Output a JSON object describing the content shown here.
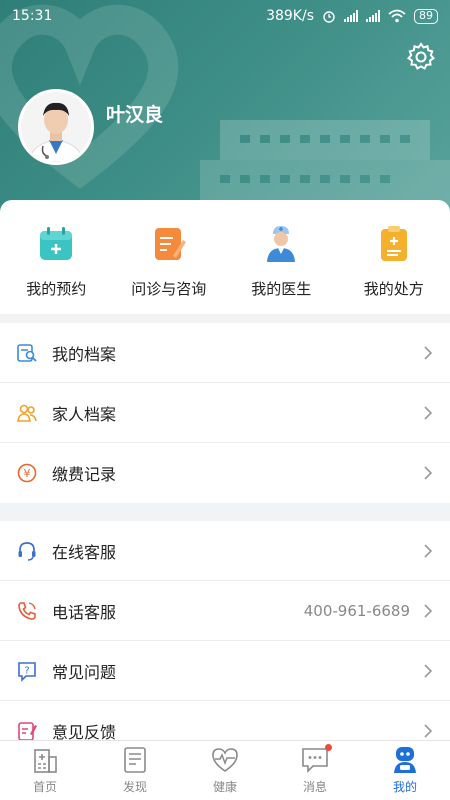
{
  "status_bar": {
    "time": "15:31",
    "network_speed": "389K/s",
    "battery": "89"
  },
  "profile": {
    "name": "叶汉良",
    "settings_icon": "gear-icon"
  },
  "quick_actions": [
    {
      "label": "我的预约",
      "icon": "calendar-icon",
      "color": "#3cc4c2"
    },
    {
      "label": "问诊与咨询",
      "icon": "consult-note-icon",
      "color": "#f58a3d"
    },
    {
      "label": "我的医生",
      "icon": "doctor-icon",
      "color": "#3c8ad8"
    },
    {
      "label": "我的处方",
      "icon": "prescription-icon",
      "color": "#f5b12e"
    }
  ],
  "records_menu": [
    {
      "label": "我的档案",
      "icon": "profile-search-icon"
    },
    {
      "label": "家人档案",
      "icon": "family-icon"
    },
    {
      "label": "缴费记录",
      "icon": "payment-icon"
    }
  ],
  "service_menu": [
    {
      "label": "在线客服",
      "icon": "headset-icon",
      "value": ""
    },
    {
      "label": "电话客服",
      "icon": "phone-icon",
      "value": "400-961-6689"
    },
    {
      "label": "常见问题",
      "icon": "faq-icon",
      "value": ""
    },
    {
      "label": "意见反馈",
      "icon": "feedback-icon",
      "value": ""
    }
  ],
  "tabs": [
    {
      "label": "首页",
      "icon": "hospital-icon"
    },
    {
      "label": "发现",
      "icon": "discover-icon"
    },
    {
      "label": "健康",
      "icon": "heart-pulse-icon"
    },
    {
      "label": "消息",
      "icon": "message-icon",
      "badge": true
    },
    {
      "label": "我的",
      "icon": "robot-avatar-icon",
      "active": true
    }
  ],
  "colors": {
    "header": "#3d8e86",
    "accent": "#1f6fd8",
    "badge": "#f04a3a"
  }
}
